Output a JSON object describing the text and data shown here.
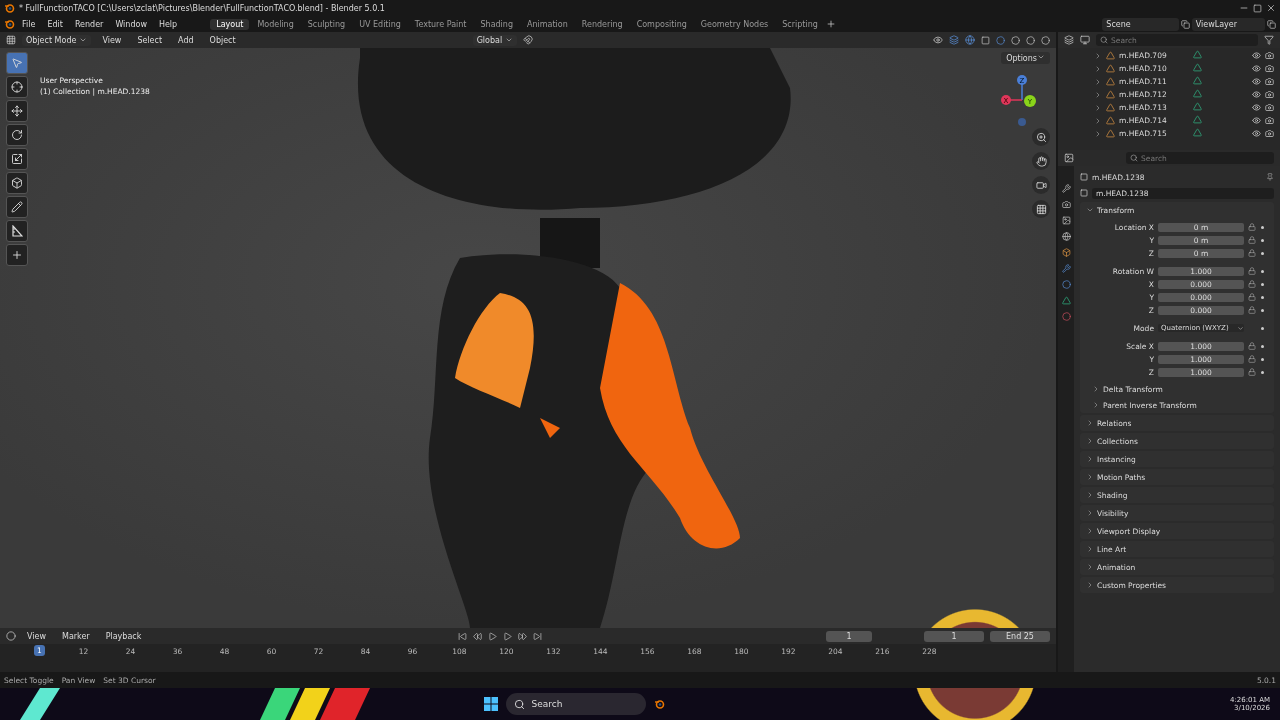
{
  "title_bar": {
    "title": "* FullFunctionTACO [C:\\Users\\zclat\\Pictures\\Blender\\FullFunctionTACO.blend] - Blender 5.0.1"
  },
  "menu": [
    "File",
    "Edit",
    "Render",
    "Window",
    "Help"
  ],
  "workspaces": [
    {
      "label": "Layout",
      "selected": true
    },
    {
      "label": "Modeling",
      "selected": false
    },
    {
      "label": "Sculpting",
      "selected": false
    },
    {
      "label": "UV Editing",
      "selected": false
    },
    {
      "label": "Texture Paint",
      "selected": false
    },
    {
      "label": "Shading",
      "selected": false
    },
    {
      "label": "Animation",
      "selected": false
    },
    {
      "label": "Rendering",
      "selected": false
    },
    {
      "label": "Compositing",
      "selected": false
    },
    {
      "label": "Geometry Nodes",
      "selected": false
    },
    {
      "label": "Scripting",
      "selected": false
    }
  ],
  "scene": "Scene",
  "view_layer": "ViewLayer",
  "viewport": {
    "mode": "Object Mode",
    "menus": [
      "View",
      "Select",
      "Add",
      "Object"
    ],
    "orientation": "Global",
    "options": "Options",
    "view_name": "User Perspective",
    "collection": "(1) Collection | m.HEAD.1238",
    "tools": [
      {
        "kind": "select",
        "selected": true
      },
      {
        "kind": "cursor",
        "selected": false
      },
      {
        "kind": "move",
        "selected": false
      },
      {
        "kind": "rotate",
        "selected": false
      },
      {
        "kind": "scale",
        "selected": false
      },
      {
        "kind": "transform",
        "selected": false
      },
      {
        "kind": "annotate",
        "selected": false
      },
      {
        "kind": "measure",
        "selected": false
      },
      {
        "kind": "add",
        "selected": false
      }
    ],
    "axes": [
      "X",
      "Y",
      "Z"
    ]
  },
  "outliner": {
    "search_placeholder": "Search",
    "items": [
      {
        "name": "m.HEAD.709"
      },
      {
        "name": "m.HEAD.710"
      },
      {
        "name": "m.HEAD.711"
      },
      {
        "name": "m.HEAD.712"
      },
      {
        "name": "m.HEAD.713"
      },
      {
        "name": "m.HEAD.714"
      },
      {
        "name": "m.HEAD.715"
      }
    ]
  },
  "properties": {
    "search_placeholder": "Search",
    "object_name": "m.HEAD.1238",
    "data_name": "m.HEAD.1238",
    "transform_groups": [
      [
        {
          "label": "Location X",
          "value": "0 m"
        },
        {
          "label": "Y",
          "value": "0 m"
        },
        {
          "label": "Z",
          "value": "0 m"
        }
      ],
      [
        {
          "label": "Rotation W",
          "value": "1.000"
        },
        {
          "label": "X",
          "value": "0.000"
        },
        {
          "label": "Y",
          "value": "0.000"
        },
        {
          "label": "Z",
          "value": "0.000"
        }
      ],
      [
        {
          "label": "Mode",
          "value": "Quaternion (WXYZ)",
          "kind": "dropdown"
        }
      ],
      [
        {
          "label": "Scale X",
          "value": "1.000"
        },
        {
          "label": "Y",
          "value": "1.000"
        },
        {
          "label": "Z",
          "value": "1.000"
        }
      ]
    ],
    "subpanels": [
      {
        "title": "Delta Transform",
        "expanded": false
      },
      {
        "title": "Parent Inverse Transform",
        "expanded": false
      }
    ],
    "panels": [
      {
        "title": "Transform",
        "expanded": true
      },
      {
        "title": "Relations",
        "expanded": false
      },
      {
        "title": "Collections",
        "expanded": false
      },
      {
        "title": "Instancing",
        "expanded": false
      },
      {
        "title": "Motion Paths",
        "expanded": false
      },
      {
        "title": "Shading",
        "expanded": false
      },
      {
        "title": "Visibility",
        "expanded": false
      },
      {
        "title": "Viewport Display",
        "expanded": false
      },
      {
        "title": "Line Art",
        "expanded": false
      },
      {
        "title": "Animation",
        "expanded": false
      },
      {
        "title": "Custom Properties",
        "expanded": false
      }
    ]
  },
  "timeline": {
    "menus": [
      "View",
      "Marker",
      "Playback"
    ],
    "current_frame": "1",
    "start": "1",
    "end_label": "End",
    "end": "25",
    "playhead": "1",
    "ticks": [
      "12",
      "24",
      "36",
      "48",
      "60",
      "72",
      "84",
      "96",
      "108",
      "120",
      "132",
      "144",
      "156",
      "168",
      "180",
      "192",
      "204",
      "216",
      "228"
    ]
  },
  "status_bar": {
    "hints": [
      "Select Toggle",
      "Pan View",
      "Set 3D Cursor"
    ],
    "version": "5.0.1"
  },
  "taskbar": {
    "search": "Search",
    "time": "4:26:01 AM",
    "date": "3/10/2026"
  }
}
